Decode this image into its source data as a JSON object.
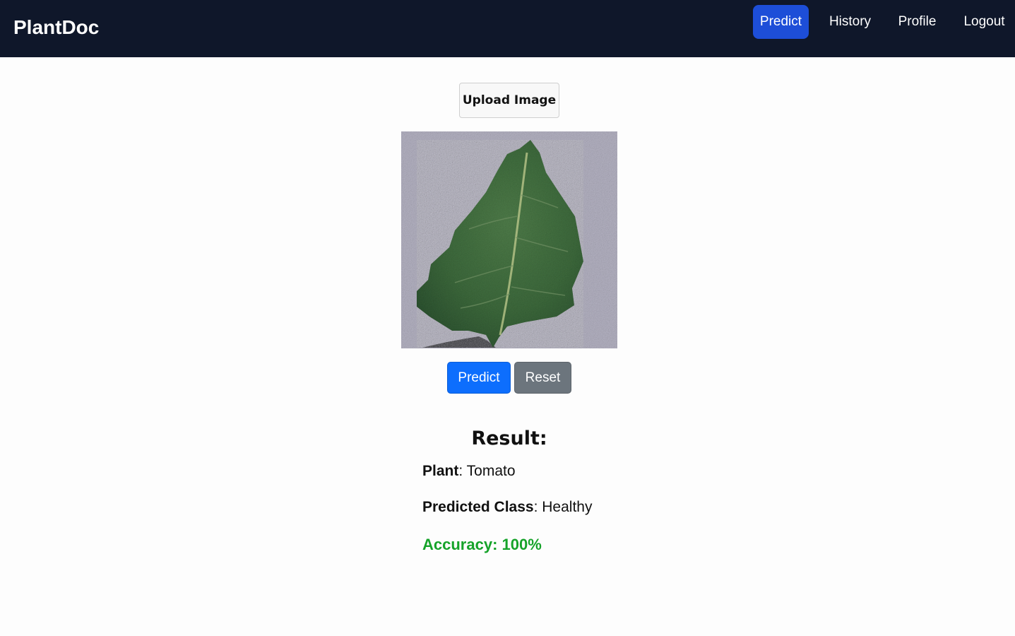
{
  "app": {
    "brand": "PlantDoc"
  },
  "nav": {
    "items": [
      {
        "label": "Predict",
        "active": true
      },
      {
        "label": "History",
        "active": false
      },
      {
        "label": "Profile",
        "active": false
      },
      {
        "label": "Logout",
        "active": false
      }
    ]
  },
  "upload": {
    "label": "Upload Image"
  },
  "image": {
    "subject": "leaf-image"
  },
  "actions": {
    "predict_label": "Predict",
    "reset_label": "Reset"
  },
  "result": {
    "title": "Result:",
    "plant_label": "Plant",
    "plant_value": "Tomato",
    "class_label": "Predicted Class",
    "class_value": "Healthy",
    "accuracy_text": "Accuracy: 100%"
  },
  "colors": {
    "navbar": "#0f172a",
    "nav_active": "#1d4ed8",
    "predict_button": "#0d6efd",
    "reset_button": "#6c757d",
    "accuracy": "#16a32a"
  }
}
